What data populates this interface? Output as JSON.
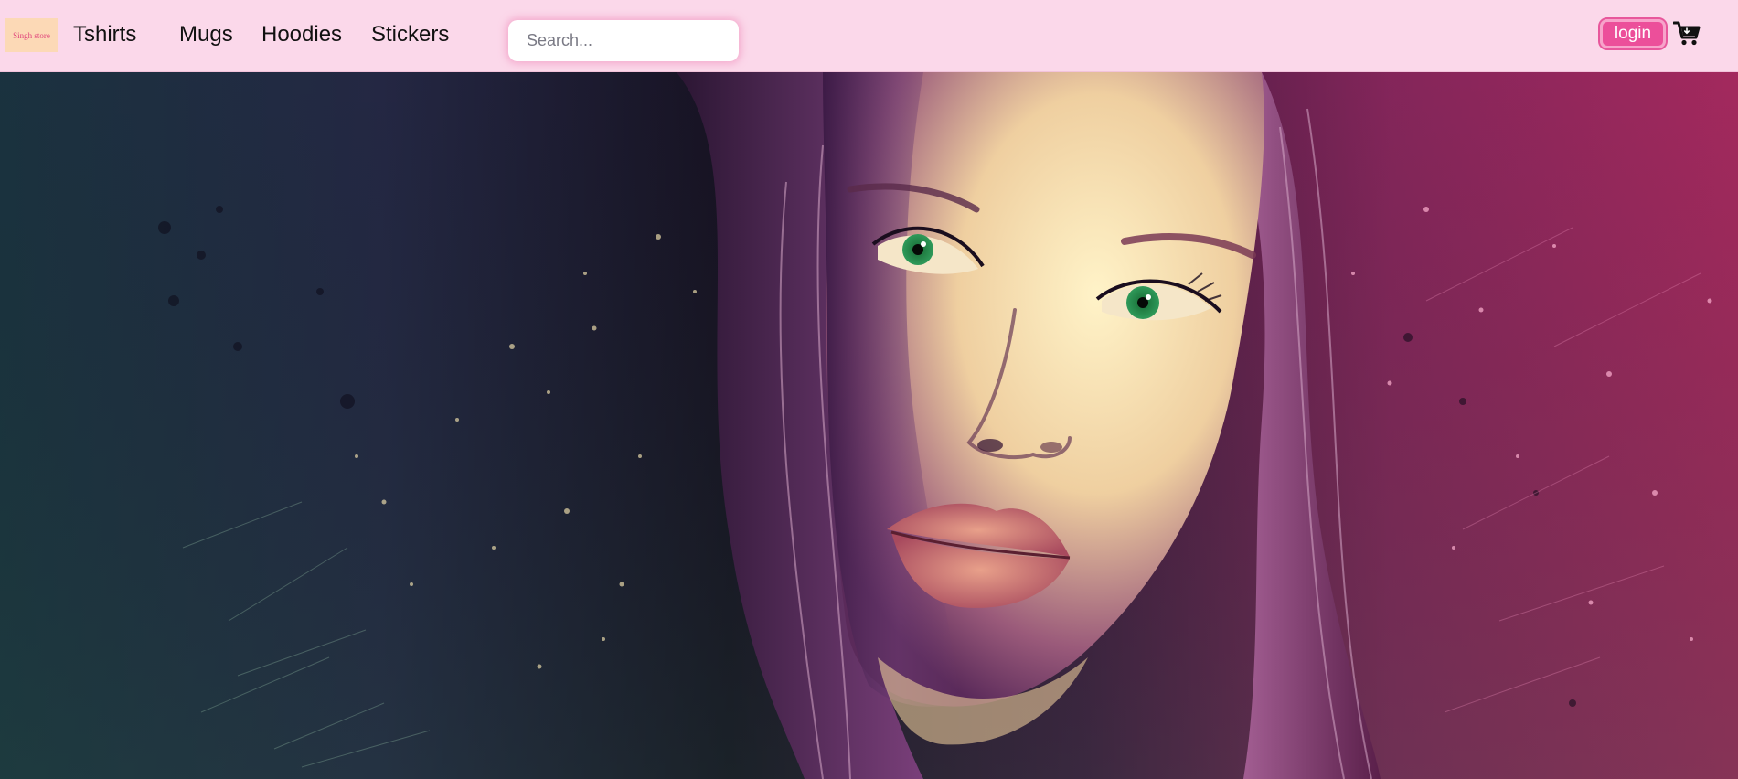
{
  "navbar": {
    "logo_text": "Singh store",
    "links": [
      {
        "label": "Tshirts"
      },
      {
        "label": "Mugs"
      },
      {
        "label": "Hoodies"
      },
      {
        "label": "Stickers"
      }
    ],
    "search": {
      "placeholder": "Search...",
      "value": ""
    },
    "login_label": "login",
    "cart_icon": "cart-icon"
  },
  "hero": {
    "image": "hero-portrait-image",
    "colors": {
      "left": "#1f3b4a",
      "center": "#5a2f6b",
      "right": "#c0306e",
      "skin": "#f3dcae",
      "eyes": "#2f9a5a",
      "lips": "#c46a70"
    }
  },
  "theme": {
    "navbar_bg": "#fbd8ea",
    "accent": "#ec4f9a",
    "logo_bg": "#fcd9b6",
    "logo_text_color": "#e0457b"
  }
}
